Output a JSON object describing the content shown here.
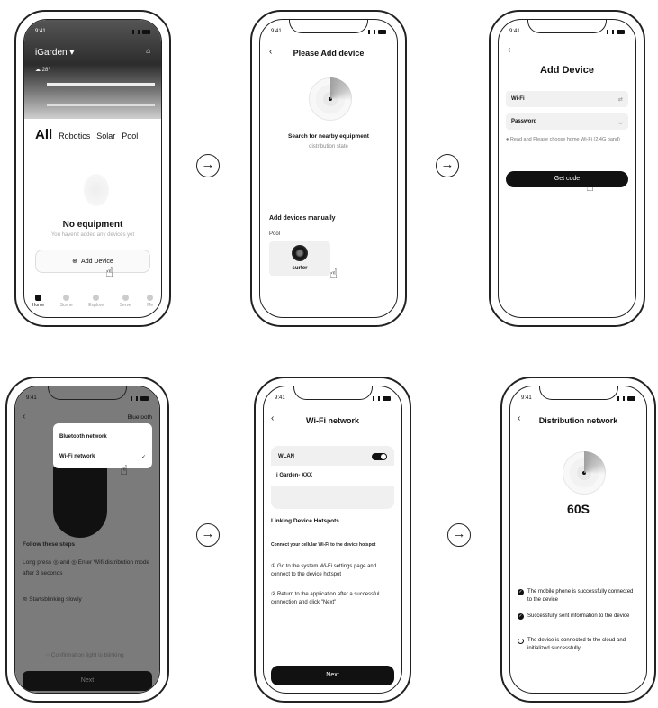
{
  "status_time": "9:41",
  "screen1": {
    "brand": "iGarden",
    "weather": "28°",
    "tabs": [
      "All",
      "Robotics",
      "Solar",
      "Pool"
    ],
    "empty_title": "No equipment",
    "empty_sub": "You haven't added any devices yet",
    "add_device": "Add Device",
    "nav": [
      "Home",
      "Scene",
      "Explore",
      "Serve",
      "Me"
    ]
  },
  "screen2": {
    "title": "Please Add device",
    "search_title": "Search for nearby equipment",
    "search_sub": "distribution state",
    "manual_heading": "Add devices manually",
    "category": "Pool",
    "device_name": "surfer"
  },
  "screen3": {
    "title": "Add Device",
    "wifi_label": "Wi-Fi",
    "password_label": "Password",
    "note": "Read and Please choose home Wi-Fi (2.4G band)",
    "button": "Get code"
  },
  "screen4": {
    "header_right": "Bluetooth",
    "options": [
      "Bluetooth network",
      "Wi-Fi network"
    ],
    "check": "✓",
    "steps_heading": "Follow these steps",
    "instruction_prefix": "Long press",
    "instruction_middle": "and",
    "instruction_suffix": "Enter Wifi distribution mode after 3 seconds",
    "blink": "Startsblinking slowly",
    "confirm": "Confirmation light is blinking",
    "next": "Next"
  },
  "screen5": {
    "title": "Wi-Fi network",
    "wlan": "WLAN",
    "wifi_name": "i Garden- XXX",
    "hotspots_heading": "Linking Device Hotspots",
    "connect_text": "Connect your cellular Wi-Fi to the device hotspot",
    "step1": "① Go to the system Wi-Fi settings page and connect to the device hotspot",
    "step2": "② Return to the application after a successful connection and click \"Next\"",
    "next": "Next"
  },
  "screen6": {
    "title": "Distribution network",
    "countdown": "60S",
    "items": [
      "The mobile phone is successfully connected to the device",
      "Successfully sent information to the device",
      "The device is connected to the cloud and initialized successfully"
    ]
  }
}
